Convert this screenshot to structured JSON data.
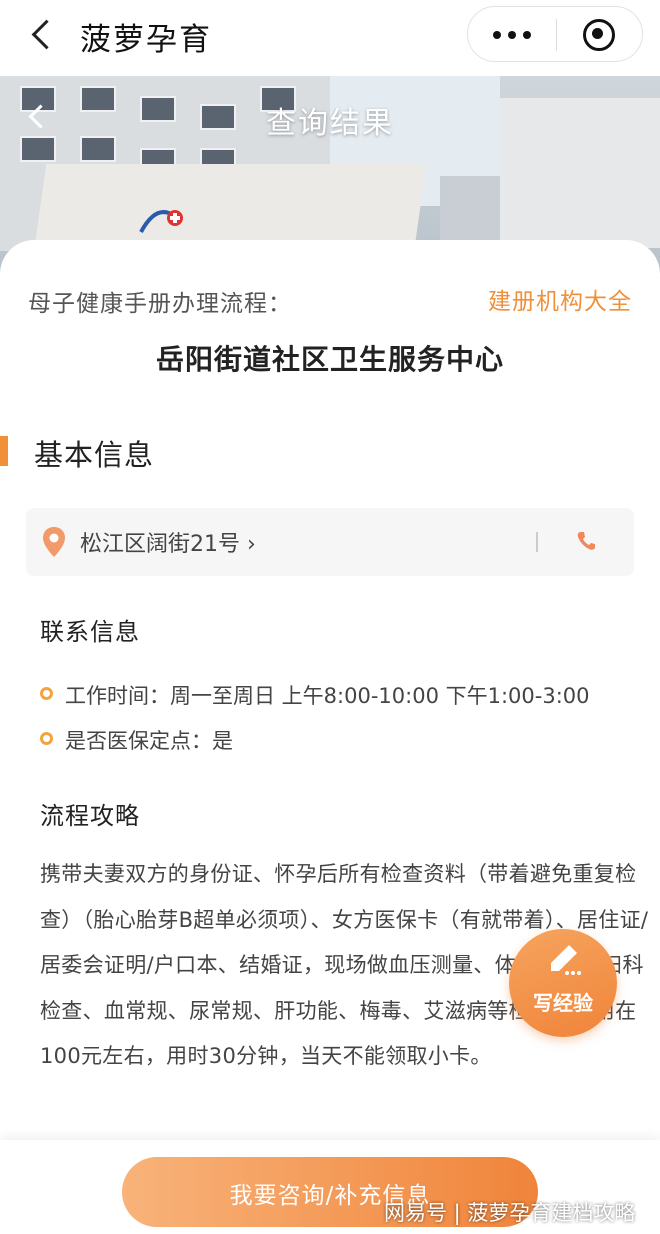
{
  "nav": {
    "title": "菠萝孕育"
  },
  "banner": {
    "title": "查询结果"
  },
  "card": {
    "flow_label": "母子健康手册办理流程：",
    "institutions_link": "建册机构大全",
    "center_name": "岳阳街道社区卫生服务中心"
  },
  "basic_info": {
    "title": "基本信息",
    "address": "松江区阔街21号 ›"
  },
  "contact": {
    "title": "联系信息",
    "items": [
      "工作时间：周一至周日 上午8:00-10:00 下午1:00-3:00",
      "是否医保定点：是"
    ]
  },
  "flow": {
    "title": "流程攻略",
    "text": "携带夫妻双方的身份证、怀孕后所有检查资料（带着避免重复检查）（胎心胎芽B超单必须项）、女方医保卡（有就带着）、居住证/居委会证明/户口本、结婚证，现场做血压测量、体重检查、妇科检查、血常规、尿常规、肝功能、梅毒、艾滋病等检查，费用在100元左右，用时30分钟，当天不能领取小卡。"
  },
  "write_button": {
    "label": "写经验"
  },
  "bottom": {
    "consult_label": "我要咨询/补充信息",
    "watermark": "网易号 | 菠萝孕育建档攻略"
  },
  "colors": {
    "accent": "#f0913a",
    "dot": "#f3a441"
  }
}
